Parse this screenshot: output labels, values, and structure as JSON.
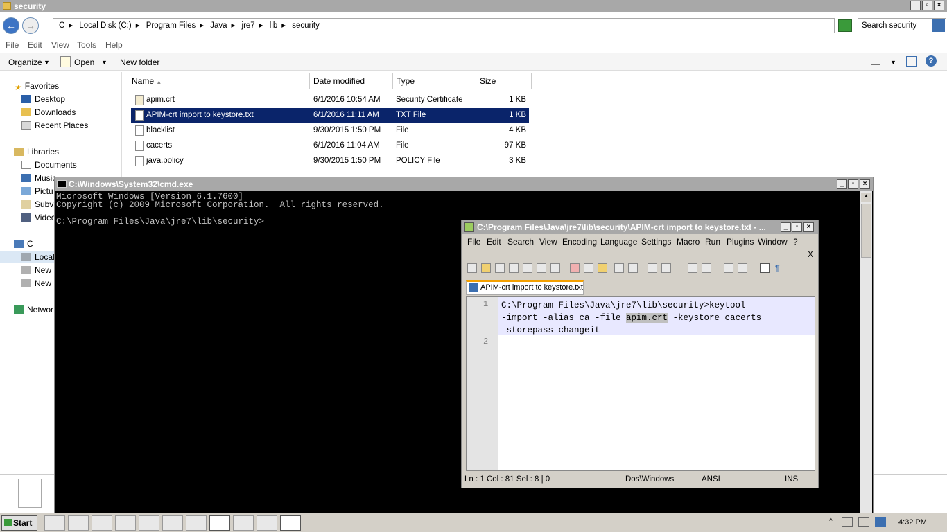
{
  "explorer": {
    "title": "security",
    "address": [
      "C",
      "Local Disk (C:)",
      "Program Files",
      "Java",
      "jre7",
      "lib",
      "security"
    ],
    "search_placeholder": "Search security",
    "menu": [
      "File",
      "Edit",
      "View",
      "Tools",
      "Help"
    ],
    "toolbar": {
      "organize": "Organize",
      "open": "Open",
      "new_folder": "New folder"
    },
    "nav": {
      "favorites": "Favorites",
      "desktop": "Desktop",
      "downloads": "Downloads",
      "recent": "Recent Places",
      "libraries": "Libraries",
      "documents": "Documents",
      "music": "Music",
      "pictures": "Pictu",
      "subversion": "Subv",
      "videos": "Video",
      "computer": "C",
      "local": "Local",
      "new1": "New",
      "new2": "New",
      "network": "Networ"
    },
    "columns": {
      "name": "Name",
      "date": "Date modified",
      "type": "Type",
      "size": "Size"
    },
    "files": [
      {
        "name": "apim.crt",
        "date": "6/1/2016 10:54 AM",
        "type": "Security Certificate",
        "size": "1 KB"
      },
      {
        "name": "APIM-crt import to keystore.txt",
        "date": "6/1/2016 11:11 AM",
        "type": "TXT File",
        "size": "1 KB"
      },
      {
        "name": "blacklist",
        "date": "9/30/2015 1:50 PM",
        "type": "File",
        "size": "4 KB"
      },
      {
        "name": "cacerts",
        "date": "6/1/2016 11:04 AM",
        "type": "File",
        "size": "97 KB"
      },
      {
        "name": "java.policy",
        "date": "9/30/2015 1:50 PM",
        "type": "POLICY File",
        "size": "3 KB"
      }
    ]
  },
  "cmd": {
    "title": "C:\\Windows\\System32\\cmd.exe",
    "lines": [
      "Microsoft Windows [Version 6.1.7600]",
      "Copyright (c) 2009 Microsoft Corporation.  All rights reserved.",
      "",
      "C:\\Program Files\\Java\\jre7\\lib\\security>"
    ]
  },
  "npp": {
    "title": "C:\\Program Files\\Java\\jre7\\lib\\security\\APIM-crt import to keystore.txt - ...",
    "menu": [
      "File",
      "Edit",
      "Search",
      "View",
      "Encoding",
      "Language",
      "Settings",
      "Macro",
      "Run",
      "Plugins",
      "Window",
      "?"
    ],
    "close_x": "X",
    "tab": "APIM-crt import to keystore.txt",
    "line_numbers": [
      "1",
      "2"
    ],
    "code": {
      "l1": "C:\\Program Files\\Java\\jre7\\lib\\security>keytool",
      "l2a": "-import -alias ca -file ",
      "l2hl": "apim.crt",
      "l2b": " -keystore cacerts",
      "l3": "-storepass changeit"
    },
    "status": {
      "pos": "Ln : 1    Col : 81    Sel : 8 | 0",
      "eol": "Dos\\Windows",
      "enc": "ANSI",
      "mode": "INS"
    }
  },
  "taskbar": {
    "start": "Start",
    "clock": "4:32 PM"
  }
}
